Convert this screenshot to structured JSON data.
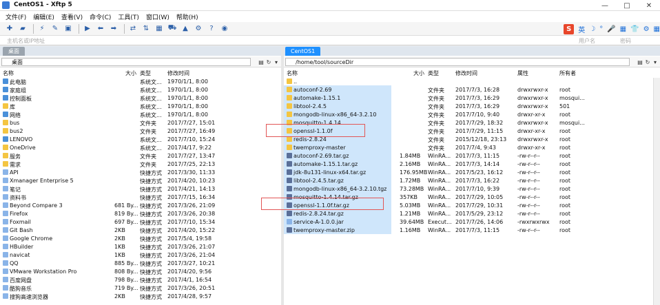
{
  "window": {
    "title": "CentOS1  - Xftp 5",
    "minimize": "—",
    "maximize": "□",
    "close": "✕"
  },
  "menu": [
    "文件(F)",
    "编辑(E)",
    "查看(V)",
    "命令(C)",
    "工具(T)",
    "窗口(W)",
    "帮助(H)"
  ],
  "ime": {
    "logo": "S",
    "lang": "英",
    "items": [
      "☽",
      "°",
      "🎤",
      "▦",
      "👕",
      "⚙",
      "▦"
    ]
  },
  "address": {
    "host_placeholder": "主机名或IP地址",
    "user_placeholder": "用户名",
    "pass_placeholder": "密码"
  },
  "left": {
    "tab": "桌面",
    "path": "桌面",
    "headers": {
      "name": "名称",
      "size": "大小",
      "type": "类型",
      "mtime": "修改时间"
    },
    "rows": [
      {
        "name": "此电脑",
        "size": "",
        "type": "系统文...",
        "mtime": "1970/1/1, 8:00",
        "icon": "sys"
      },
      {
        "name": "家庭组",
        "size": "",
        "type": "系统文...",
        "mtime": "1970/1/1, 8:00",
        "icon": "sys"
      },
      {
        "name": "控制面板",
        "size": "",
        "type": "系统文...",
        "mtime": "1970/1/1, 8:00",
        "icon": "sys"
      },
      {
        "name": "库",
        "size": "",
        "type": "系统文...",
        "mtime": "1970/1/1, 8:00",
        "icon": "folder"
      },
      {
        "name": "网络",
        "size": "",
        "type": "系统文...",
        "mtime": "1970/1/1, 8:00",
        "icon": "sys"
      },
      {
        "name": "bus",
        "size": "",
        "type": "文件夹",
        "mtime": "2017/7/27, 15:01",
        "icon": "folder"
      },
      {
        "name": "bus2",
        "size": "",
        "type": "文件夹",
        "mtime": "2017/7/27, 16:49",
        "icon": "folder"
      },
      {
        "name": "LENOVO",
        "size": "",
        "type": "系统文...",
        "mtime": "2017/7/10, 15:24",
        "icon": "sys"
      },
      {
        "name": "OneDrive",
        "size": "",
        "type": "系统文...",
        "mtime": "2017/4/17, 9:22",
        "icon": "folder"
      },
      {
        "name": "服务",
        "size": "",
        "type": "文件夹",
        "mtime": "2017/7/27, 13:47",
        "icon": "folder"
      },
      {
        "name": "需求",
        "size": "",
        "type": "文件夹",
        "mtime": "2017/7/25, 22:13",
        "icon": "folder"
      },
      {
        "name": "API",
        "size": "",
        "type": "快捷方式",
        "mtime": "2017/3/30, 11:33",
        "icon": "scut"
      },
      {
        "name": "Xmanager Enterprise 5",
        "size": "",
        "type": "快捷方式",
        "mtime": "2017/4/20, 10:23",
        "icon": "scut"
      },
      {
        "name": "笔记",
        "size": "",
        "type": "快捷方式",
        "mtime": "2017/4/21, 14:13",
        "icon": "scut"
      },
      {
        "name": "资料书",
        "size": "",
        "type": "快捷方式",
        "mtime": "2017/7/15, 16:34",
        "icon": "scut"
      },
      {
        "name": "Beyond Compare 3",
        "size": "681 By...",
        "type": "快捷方式",
        "mtime": "2017/3/26, 21:09",
        "icon": "scut"
      },
      {
        "name": "Firefox",
        "size": "819 By...",
        "type": "快捷方式",
        "mtime": "2017/3/26, 20:38",
        "icon": "scut"
      },
      {
        "name": "Foxmail",
        "size": "697 By...",
        "type": "快捷方式",
        "mtime": "2017/7/10, 15:34",
        "icon": "scut"
      },
      {
        "name": "Git Bash",
        "size": "2KB",
        "type": "快捷方式",
        "mtime": "2017/4/20, 15:22",
        "icon": "scut"
      },
      {
        "name": "Google Chrome",
        "size": "2KB",
        "type": "快捷方式",
        "mtime": "2017/5/4, 19:58",
        "icon": "scut"
      },
      {
        "name": "HBuilder",
        "size": "1KB",
        "type": "快捷方式",
        "mtime": "2017/3/26, 21:07",
        "icon": "scut"
      },
      {
        "name": "navicat",
        "size": "1KB",
        "type": "快捷方式",
        "mtime": "2017/3/26, 21:04",
        "icon": "scut"
      },
      {
        "name": "QQ",
        "size": "885 By...",
        "type": "快捷方式",
        "mtime": "2017/3/27, 10:21",
        "icon": "scut"
      },
      {
        "name": "VMware Workstation Pro",
        "size": "808 By...",
        "type": "快捷方式",
        "mtime": "2017/4/20, 9:56",
        "icon": "scut"
      },
      {
        "name": "百度网盘",
        "size": "798 By...",
        "type": "快捷方式",
        "mtime": "2017/4/1, 16:54",
        "icon": "scut"
      },
      {
        "name": "酷狗音乐",
        "size": "719 By...",
        "type": "快捷方式",
        "mtime": "2017/3/26, 20:51",
        "icon": "scut"
      },
      {
        "name": "搜狗高速浏览器",
        "size": "2KB",
        "type": "快捷方式",
        "mtime": "2017/4/28, 9:57",
        "icon": "scut"
      }
    ]
  },
  "right": {
    "tab": "CentOS1",
    "path": "/home/tool/sourceDir",
    "headers": {
      "name": "名称",
      "size": "大小",
      "type": "类型",
      "mtime": "修改时间",
      "attr": "属性",
      "owner": "所有者"
    },
    "rows": [
      {
        "name": "..",
        "size": "",
        "type": "",
        "mtime": "",
        "attr": "",
        "owner": "",
        "icon": "folder"
      },
      {
        "name": "autoconf-2.69",
        "size": "",
        "type": "文件夹",
        "mtime": "2017/7/3, 16:28",
        "attr": "drwxrwxr-x",
        "owner": "root",
        "icon": "folder"
      },
      {
        "name": "automake-1.15.1",
        "size": "",
        "type": "文件夹",
        "mtime": "2017/7/3, 16:29",
        "attr": "drwxrwxr-x",
        "owner": "mosqui...",
        "icon": "folder"
      },
      {
        "name": "libtool-2.4.5",
        "size": "",
        "type": "文件夹",
        "mtime": "2017/7/3, 16:29",
        "attr": "drwxrwxr-x",
        "owner": "501",
        "icon": "folder"
      },
      {
        "name": "mongodb-linux-x86_64-3.2.10",
        "size": "",
        "type": "文件夹",
        "mtime": "2017/7/10, 9:40",
        "attr": "drwxr-xr-x",
        "owner": "root",
        "icon": "folder"
      },
      {
        "name": "mosquitto-1.4.14",
        "size": "",
        "type": "文件夹",
        "mtime": "2017/7/29, 18:32",
        "attr": "drwxrwxr-x",
        "owner": "mosqui...",
        "icon": "folder"
      },
      {
        "name": "openssl-1.1.0f",
        "size": "",
        "type": "文件夹",
        "mtime": "2017/7/29, 11:15",
        "attr": "drwxr-xr-x",
        "owner": "root",
        "icon": "folder"
      },
      {
        "name": "redis-2.8.24",
        "size": "",
        "type": "文件夹",
        "mtime": "2015/12/18, 23:13",
        "attr": "drwxrwxr-x",
        "owner": "root",
        "icon": "folder"
      },
      {
        "name": "twemproxy-master",
        "size": "",
        "type": "文件夹",
        "mtime": "2017/7/4, 9:43",
        "attr": "drwxr-xr-x",
        "owner": "root",
        "icon": "folder"
      },
      {
        "name": "autoconf-2.69.tar.gz",
        "size": "1.84MB",
        "type": "WinRA...",
        "mtime": "2017/7/3, 11:15",
        "attr": "-rw-r--r--",
        "owner": "root",
        "icon": "file"
      },
      {
        "name": "automake-1.15.1.tar.gz",
        "size": "2.16MB",
        "type": "WinRA...",
        "mtime": "2017/7/3, 14:14",
        "attr": "-rw-r--r--",
        "owner": "root",
        "icon": "file"
      },
      {
        "name": "jdk-8u131-linux-x64.tar.gz",
        "size": "176.95MB",
        "type": "WinRA...",
        "mtime": "2017/5/23, 16:12",
        "attr": "-rw-r--r--",
        "owner": "root",
        "icon": "file"
      },
      {
        "name": "libtool-2.4.5.tar.gz",
        "size": "1.72MB",
        "type": "WinRA...",
        "mtime": "2017/7/3, 16:22",
        "attr": "-rw-r--r--",
        "owner": "root",
        "icon": "file"
      },
      {
        "name": "mongodb-linux-x86_64-3.2.10.tgz",
        "size": "73.28MB",
        "type": "WinRA...",
        "mtime": "2017/7/10, 9:39",
        "attr": "-rw-r--r--",
        "owner": "root",
        "icon": "file"
      },
      {
        "name": "mosquitto-1.4.14.tar.gz",
        "size": "357KB",
        "type": "WinRA...",
        "mtime": "2017/7/29, 10:05",
        "attr": "-rw-r--r--",
        "owner": "root",
        "icon": "file"
      },
      {
        "name": "openssl-1.1.0f.tar.gz",
        "size": "5.03MB",
        "type": "WinRA...",
        "mtime": "2017/7/29, 10:31",
        "attr": "-rw-r--r--",
        "owner": "root",
        "icon": "file"
      },
      {
        "name": "redis-2.8.24.tar.gz",
        "size": "1.21MB",
        "type": "WinRA...",
        "mtime": "2017/5/29, 23:12",
        "attr": "-rw-r--r--",
        "owner": "root",
        "icon": "file"
      },
      {
        "name": "service-A-1.0.0.jar",
        "size": "39.64MB",
        "type": "Execut...",
        "mtime": "2017/7/26, 14:06",
        "attr": "-rwxrwxrwx",
        "owner": "root",
        "icon": "scut"
      },
      {
        "name": "twemproxy-master.zip",
        "size": "1.16MB",
        "type": "WinRA...",
        "mtime": "2017/7/3, 11:15",
        "attr": "-rw-r--r--",
        "owner": "root",
        "icon": "file"
      }
    ]
  },
  "colors": {
    "tab_active": "#1e90ff",
    "tab_inactive": "#9aa4ae",
    "selection": "#cfe6fb",
    "highlight_box": "#e25555"
  }
}
